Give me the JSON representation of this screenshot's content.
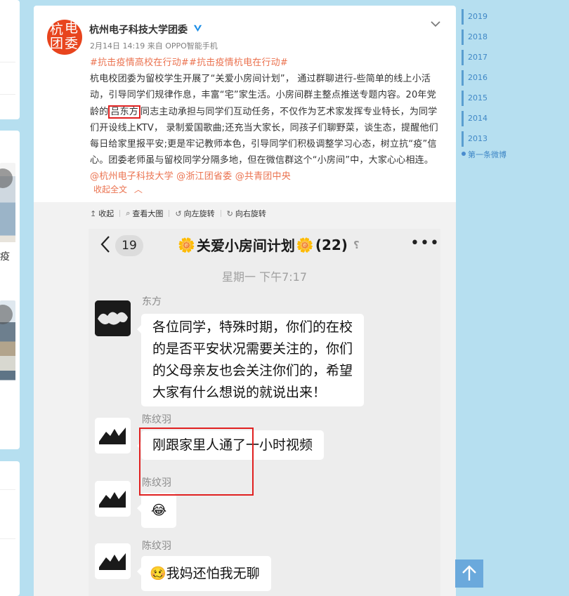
{
  "sidebar": {
    "fragment_char": "疫"
  },
  "timeline": {
    "years": [
      "2019",
      "2018",
      "2017",
      "2016",
      "2015",
      "2014",
      "2013"
    ],
    "first_post": "第一条微博"
  },
  "post": {
    "user": "杭州电子科技大学团委",
    "avatar_text": [
      "杭",
      "电",
      "团",
      "委"
    ],
    "time": "2月14日 14:19",
    "source_prefix": "来自",
    "source": "OPPO智能手机",
    "tags": "#抗击疫情高校在行动##抗击疫情杭电在行动#",
    "body_1": "杭电校团委为留校学生开展了“关爱小房间计划”， 通过群聊进行-些简单的线上小活动，引导同学们规律作息，丰富“宅”家生活。小房间群主整点推送专题内容。20年党龄的",
    "body_highlight": "吕东方",
    "body_2": "同志主动承担与同学们互动任务，不仅作为艺术家发挥专业特长，为同学们开设线上KTV， 录制爱国歌曲;还充当大家长，同孩子们聊野菜，谈生态，提醒他们每日给家里报平安;更是牢记教师本色，引导同学们积极调整学习心态，树立抗“疫”信心。团委老师虽与留校同学分隔多地，但在微信群这个“小房间”中，大家心心相连。",
    "mentions": [
      "@杭州电子科技大学",
      "@浙江团省委",
      "@共青团中央"
    ],
    "collapse_label": "收起全文"
  },
  "media_toolbar": {
    "items": [
      {
        "icon": "↥",
        "label": "收起"
      },
      {
        "icon": "⌕",
        "label": "查看大图"
      },
      {
        "icon": "↺",
        "label": "向左旋转"
      },
      {
        "icon": "↻",
        "label": "向右旋转"
      }
    ]
  },
  "chat": {
    "unread": "19",
    "title": "关爱小房间计划",
    "member_count": "(22)",
    "time": "星期一 下午7:17",
    "messages": [
      {
        "name": "东方",
        "text_lines": [
          "各位同学，特殊时期，你们的在校",
          "的是否平安状况需要关注的，你们",
          "的父母亲友也会关注你们的，希望",
          "大家有什么想说的就说出来！"
        ]
      },
      {
        "name": "陈纹羽",
        "text": "刚跟家里人通了一小时视频"
      },
      {
        "name": "陈纹羽",
        "text": "😂"
      },
      {
        "name": "陈纹羽",
        "text": "我妈还怕我无聊",
        "emoji": "🥴"
      }
    ]
  },
  "colors": {
    "background": "#b6dff0",
    "link_orange": "#eb7350",
    "highlight_red": "#e02020",
    "timeline_blue": "#3f87c6"
  }
}
